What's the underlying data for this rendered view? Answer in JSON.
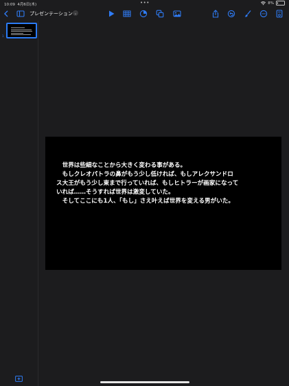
{
  "status": {
    "time": "10:09",
    "date": "4月6日(木)",
    "battery": "8%"
  },
  "toolbar": {
    "title": "プレゼンテーション",
    "icons": [
      "back-icon",
      "sidebar-icon",
      "play-icon",
      "table-icon",
      "chart-icon",
      "shape-icon",
      "media-icon",
      "share-icon",
      "undo-icon",
      "brush-icon",
      "more-icon",
      "document-icon"
    ]
  },
  "sidebar": {
    "slide_number": "1"
  },
  "slide": {
    "paragraphs": [
      "世界は些細なことから大きく変わる事がある。",
      "もしクレオパトラの鼻がもう少し低ければ、もしアレクサンドロ",
      "ス大王がもう少し東まで行っていれば、もしヒトラーが画家になって",
      "いれば……そうすれば世界は激変していた。",
      "そしてここにも1人、「もし」さえ叶えば世界を変える男がいた。"
    ]
  },
  "colors": {
    "accent": "#2f7cf6",
    "background": "#1c1c1e",
    "slide": "#000000"
  }
}
